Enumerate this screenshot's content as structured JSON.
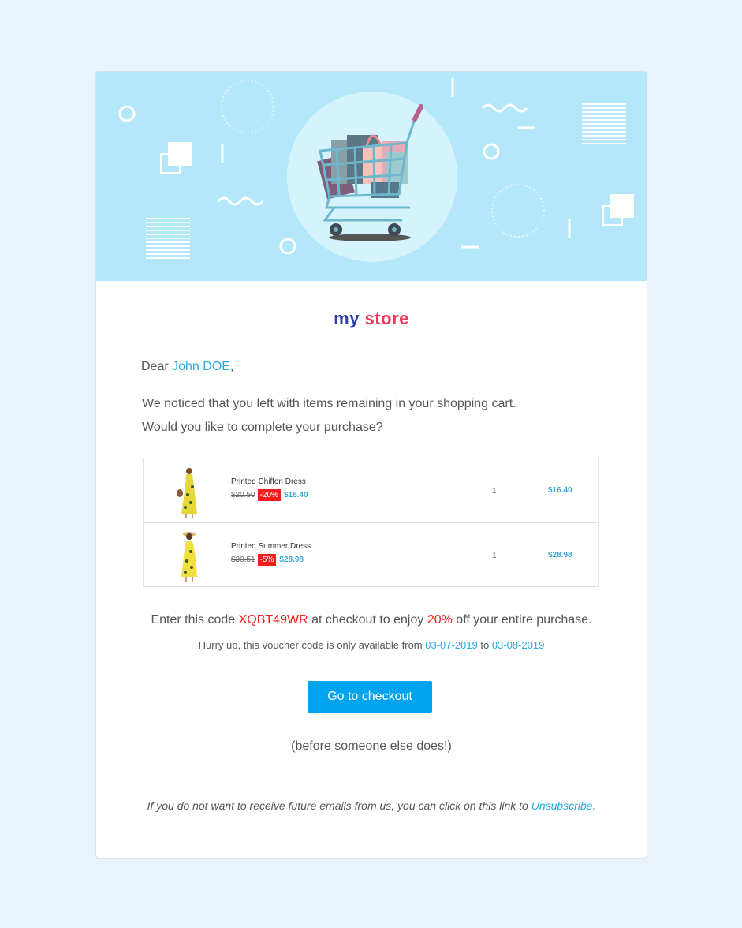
{
  "brand": {
    "my": "my",
    "store": "store"
  },
  "greeting": {
    "prefix": "Dear ",
    "name": "John DOE",
    "suffix": ","
  },
  "message": {
    "line1": "We noticed that you left with items remaining in your shopping cart.",
    "line2": "Would you like to complete your purchase?"
  },
  "items": [
    {
      "name": "Printed Chiffon Dress",
      "old_price": "$20.50",
      "discount": "-20%",
      "price": "$16.40",
      "qty": "1",
      "total": "$16.40"
    },
    {
      "name": "Printed Summer Dress",
      "old_price": "$30.51",
      "discount": "-5%",
      "price": "$28.98",
      "qty": "1",
      "total": "$28.98"
    }
  ],
  "voucher": {
    "pre": "Enter this code ",
    "code": "XQBT49WR",
    "mid": " at checkout to enjoy ",
    "percent": "20%",
    "post": " off your entire purchase.",
    "hurry_pre": "Hurry up, this voucher code is only available from ",
    "from": "03-07-2019",
    "to_word": " to ",
    "to": "03-08-2019"
  },
  "checkout_button": "Go to checkout",
  "before_text": "(before someone else does!)",
  "unsubscribe": {
    "pre": "If you do not want to receive future emails from us, you can click on this link to ",
    "link": "Unsubscribe."
  },
  "colors": {
    "accent": "#00a3ee",
    "link": "#25aae1",
    "discount": "#f21d1d",
    "hero_bg": "#b3e7f9"
  }
}
